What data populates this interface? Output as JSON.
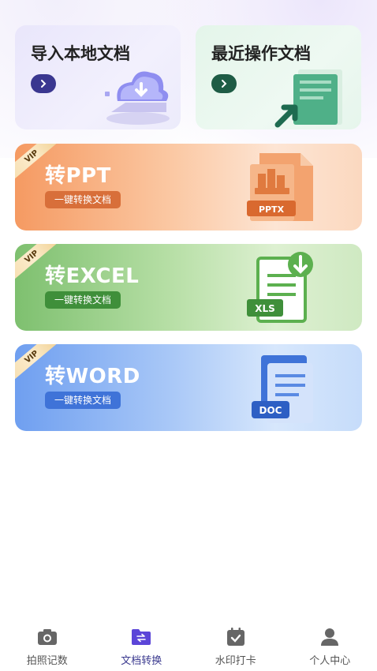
{
  "quick": {
    "import_label": "导入本地文档",
    "recent_label": "最近操作文档"
  },
  "convert": {
    "ppt": {
      "title": "转PPT",
      "subtitle": "一键转换文档",
      "badge": "VIP",
      "file_tag": "PPTX"
    },
    "excel": {
      "title": "转EXCEL",
      "subtitle": "一键转换文档",
      "badge": "VIP",
      "file_tag": "XLS"
    },
    "word": {
      "title": "转WORD",
      "subtitle": "一键转换文档",
      "badge": "VIP",
      "file_tag": "DOC"
    }
  },
  "tabs": [
    {
      "label": "拍照记数",
      "icon": "camera-icon",
      "active": false
    },
    {
      "label": "文档转换",
      "icon": "folder-convert-icon",
      "active": true
    },
    {
      "label": "水印打卡",
      "icon": "calendar-check-icon",
      "active": false
    },
    {
      "label": "个人中心",
      "icon": "user-icon",
      "active": false
    }
  ],
  "colors": {
    "accent": "#3b3a8f",
    "ppt": "#f59a62",
    "excel": "#7ec06f",
    "word": "#6f9ff0"
  }
}
